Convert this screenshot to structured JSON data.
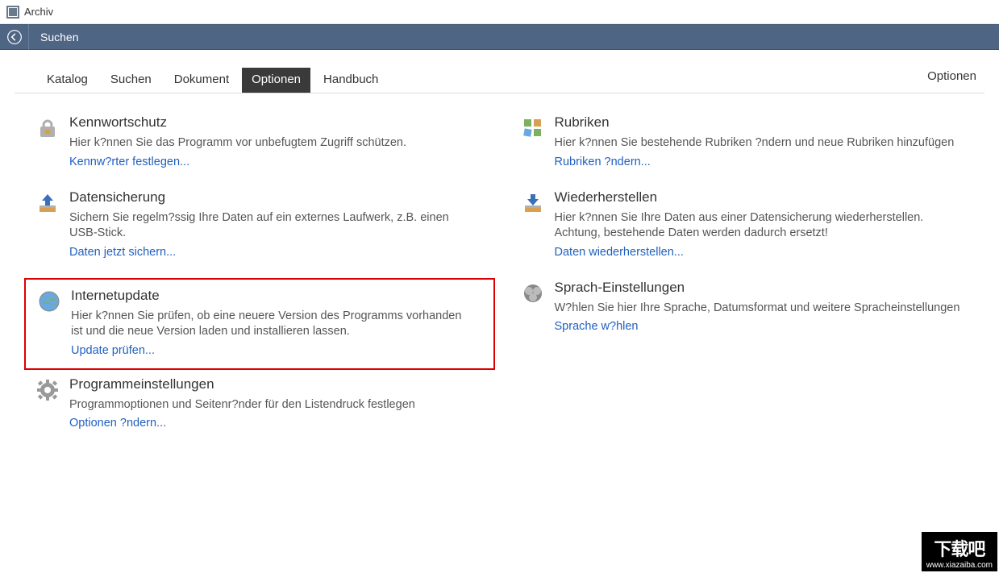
{
  "window": {
    "title": "Archiv"
  },
  "toolbar": {
    "label": "Suchen"
  },
  "tabs": [
    {
      "label": "Katalog"
    },
    {
      "label": "Suchen"
    },
    {
      "label": "Dokument"
    },
    {
      "label": "Optionen"
    },
    {
      "label": "Handbuch"
    }
  ],
  "active_tab": 3,
  "right_label": "Optionen",
  "left_items": [
    {
      "icon": "lock-icon",
      "title": "Kennwortschutz",
      "desc": "Hier k?nnen Sie das Programm vor unbefugtem Zugriff schützen.",
      "link": "Kennw?rter festlegen...",
      "highlight": false
    },
    {
      "icon": "backup-up-icon",
      "title": "Datensicherung",
      "desc": "Sichern Sie regelm?ssig Ihre Daten auf ein externes Laufwerk, z.B. einen USB-Stick.",
      "link": "Daten jetzt sichern...",
      "highlight": false
    },
    {
      "icon": "globe-icon",
      "title": "Internetupdate",
      "desc": "Hier k?nnen Sie prüfen, ob eine neuere Version des Programms vorhanden ist und die neue Version laden und installieren lassen.",
      "link": "Update prüfen...",
      "highlight": true
    },
    {
      "icon": "gear-icon",
      "title": "Programmeinstellungen",
      "desc": "Programmoptionen und Seitenr?nder für den Listendruck festlegen",
      "link": "Optionen ?ndern...",
      "highlight": false
    }
  ],
  "right_items": [
    {
      "icon": "categories-icon",
      "title": "Rubriken",
      "desc": "Hier k?nnen Sie bestehende Rubriken ?ndern und neue Rubriken hinzufügen",
      "link": "Rubriken ?ndern...",
      "highlight": false
    },
    {
      "icon": "restore-down-icon",
      "title": "Wiederherstellen",
      "desc": "Hier k?nnen Sie Ihre Daten aus einer Datensicherung wiederherstellen. Achtung, bestehende Daten werden dadurch ersetzt!",
      "link": "Daten wiederherstellen...",
      "highlight": false
    },
    {
      "icon": "language-icon",
      "title": "Sprach-Einstellungen",
      "desc": "W?hlen Sie hier Ihre Sprache, Datumsformat und weitere Spracheinstellungen",
      "link": "Sprache w?hlen",
      "highlight": false
    }
  ],
  "watermark": {
    "big": "下载吧",
    "small": "www.xiazaiba.com"
  }
}
